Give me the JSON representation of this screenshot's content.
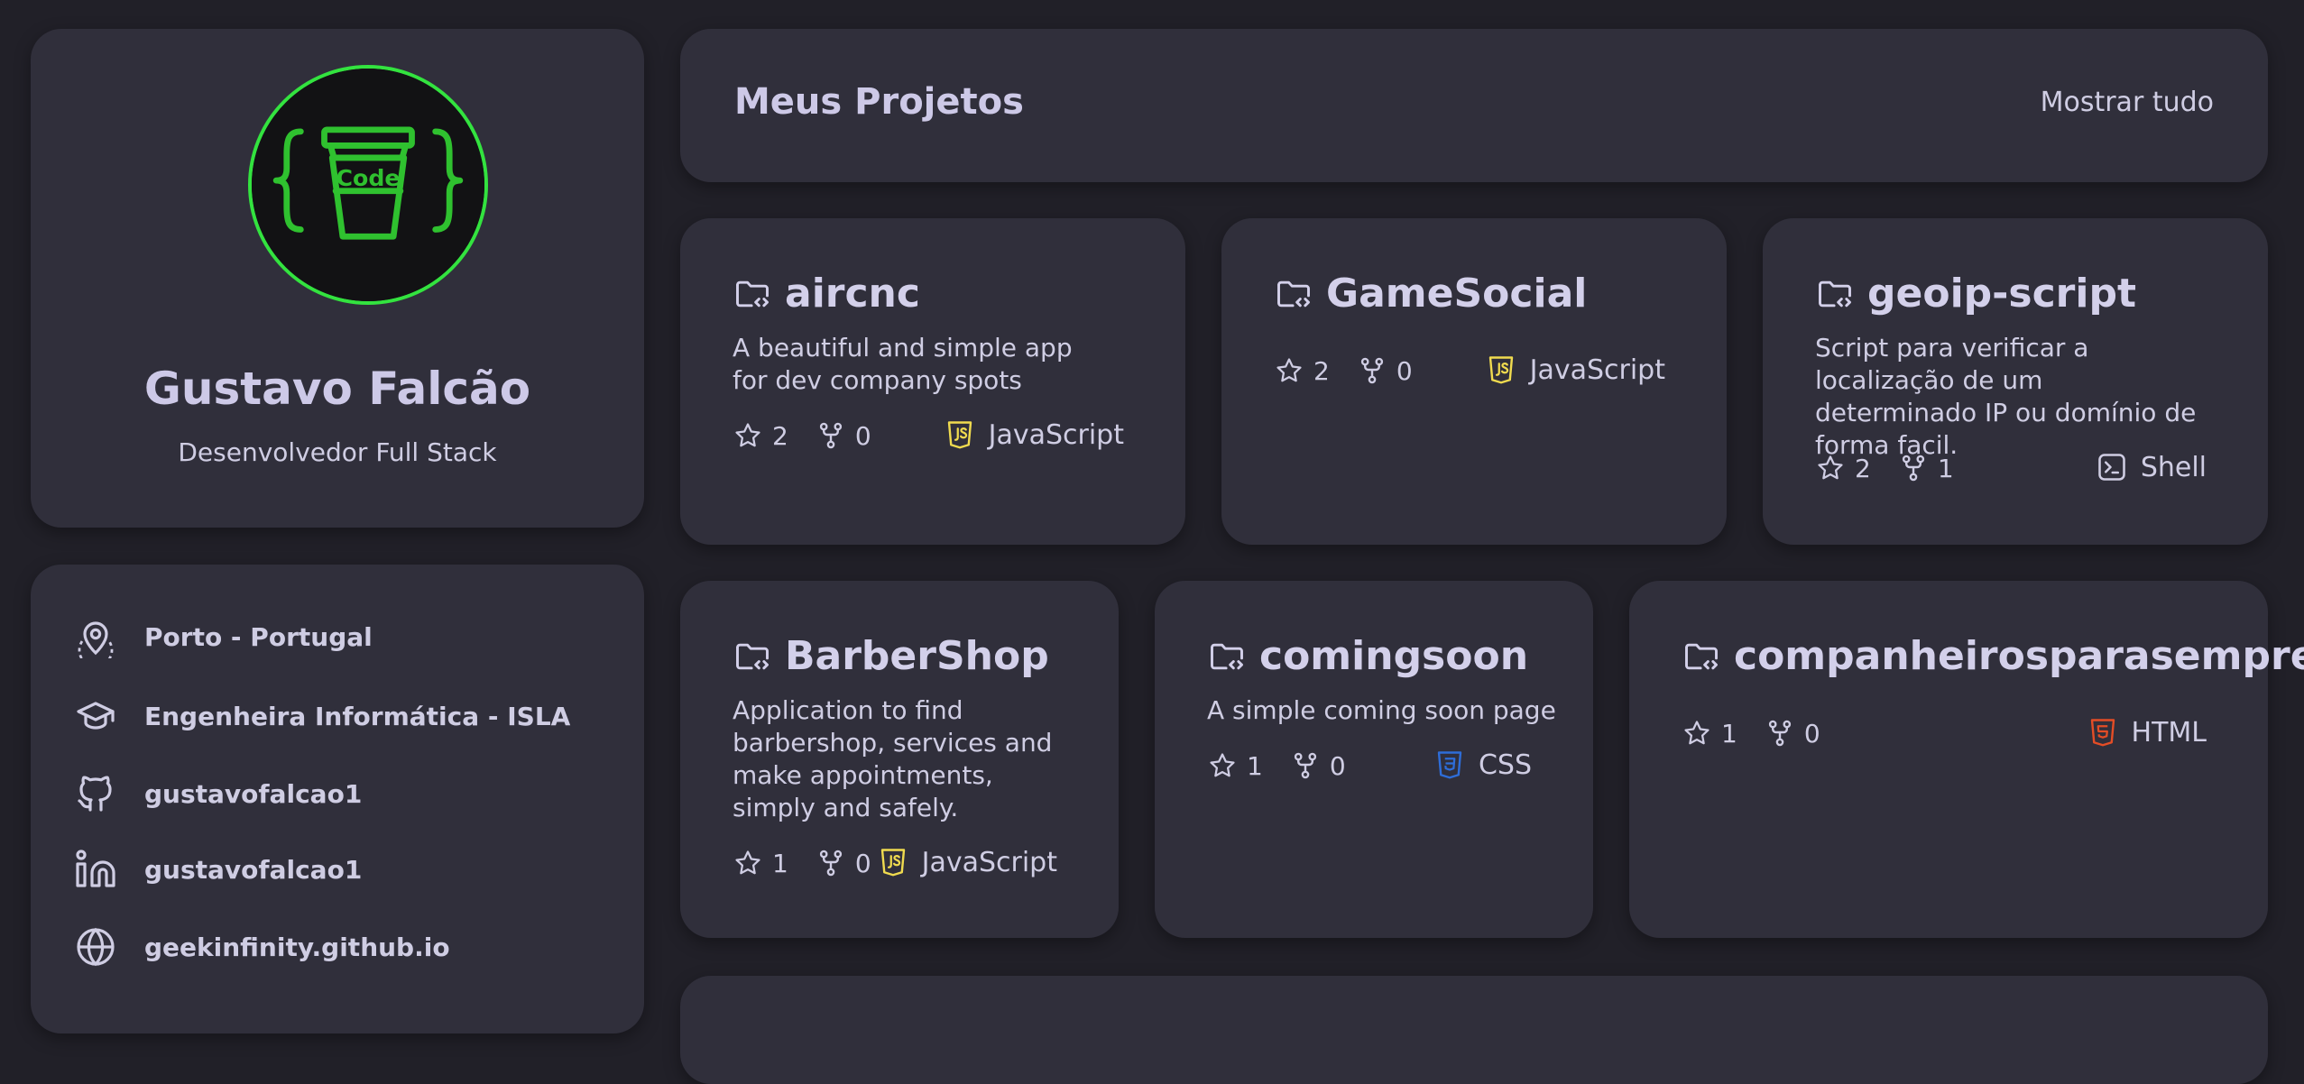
{
  "profile": {
    "name": "Gustavo Falcão",
    "role": "Desenvolvedor Full Stack",
    "avatar_text": "Code",
    "avatar_color": "#33e33f"
  },
  "info": {
    "location": "Porto - Portugal",
    "education": "Engenheira Informática - ISLA",
    "github": "gustavofalcao1",
    "linkedin": "gustavofalcao1",
    "website": "geekinfinity.github.io"
  },
  "header": {
    "title": "Meus Projetos",
    "show_all": "Mostrar tudo"
  },
  "projects": [
    {
      "name": "aircnc",
      "description": "A beautiful and simple app for dev company spots",
      "stars": "2",
      "forks": "0",
      "language": "JavaScript",
      "lang_icon": "js-icon",
      "lang_color": "#f0db4f"
    },
    {
      "name": "GameSocial",
      "description": "",
      "stars": "2",
      "forks": "0",
      "language": "JavaScript",
      "lang_icon": "js-icon",
      "lang_color": "#f0db4f"
    },
    {
      "name": "geoip-script",
      "description": "Script para verificar a localização de um determinado IP ou domínio de forma facil.",
      "stars": "2",
      "forks": "1",
      "language": "Shell",
      "lang_icon": "terminal-icon",
      "lang_color": "#cfcde3"
    },
    {
      "name": "BarberShop",
      "description": "Application to find barbershop, services and make appointments, simply and safely.",
      "stars": "1",
      "forks": "0",
      "language": "JavaScript",
      "lang_icon": "js-icon",
      "lang_color": "#f0db4f"
    },
    {
      "name": "comingsoon",
      "description": "A simple coming soon page",
      "stars": "1",
      "forks": "0",
      "language": "CSS",
      "lang_icon": "css-icon",
      "lang_color": "#2e6dd8"
    },
    {
      "name": "companheirosparasempre",
      "description": "",
      "stars": "1",
      "forks": "0",
      "language": "HTML",
      "lang_icon": "html-icon",
      "lang_color": "#e44d26"
    }
  ]
}
